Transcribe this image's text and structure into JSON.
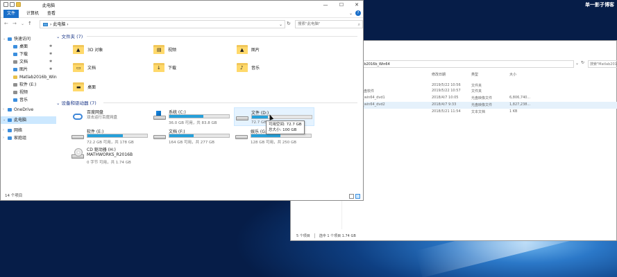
{
  "watermark": "单一影子博客",
  "back_window": {
    "address": "lab2016b_Win64",
    "search_placeholder": "搜索\"Matlab2016b_Wi...",
    "columns": [
      "修改日期",
      "类型",
      "大小"
    ],
    "rows": [
      {
        "name": "k",
        "date": "2019/5/22 10:56",
        "type": "文件夹",
        "size": ""
      },
      {
        "name": "光盘软件",
        "date": "2019/5/22 10:57",
        "type": "文件夹",
        "size": ""
      },
      {
        "name": "b_win64_dvd1",
        "date": "2018/4/7 10:05",
        "type": "光盘映像文件",
        "size": "6,806,740..."
      },
      {
        "name": "b_win64_dvd2",
        "date": "2018/4/7 9:33",
        "type": "光盘映像文件",
        "size": "1,827,238..."
      },
      {
        "name": "",
        "date": "2018/5/21 11:54",
        "type": "文本文档",
        "size": "1 KB"
      }
    ],
    "status_items": "5 个项目",
    "status_selected": "选中 1 个项目  1.74 GB"
  },
  "window": {
    "title": "此电脑",
    "controls": {
      "minimize": "—",
      "maximize": "☐",
      "close": "✕"
    },
    "ribbon_tabs": [
      "文件",
      "计算机",
      "查看"
    ],
    "address": "此电脑",
    "search_placeholder": "搜索\"此电脑\"",
    "status": "14 个项目"
  },
  "nav": [
    {
      "label": "快速访问",
      "icon": "star-icon",
      "color": "#3b8ede",
      "pinned": false
    },
    {
      "label": "桌面",
      "icon": "desktop-icon",
      "color": "#3b8ede",
      "pinned": true
    },
    {
      "label": "下载",
      "icon": "download-icon",
      "color": "#3b8ede",
      "pinned": true
    },
    {
      "label": "文档",
      "icon": "document-icon",
      "color": "#8f8f8f",
      "pinned": true
    },
    {
      "label": "图片",
      "icon": "pictures-icon",
      "color": "#3b8ede",
      "pinned": true
    },
    {
      "label": "Matlab2016b_Win",
      "icon": "folder-icon",
      "color": "#e8c04a",
      "pinned": false
    },
    {
      "label": "软件 (E:)",
      "icon": "drive-icon",
      "color": "#8f8f8f",
      "pinned": false
    },
    {
      "label": "视频",
      "icon": "video-icon",
      "color": "#8f8f8f",
      "pinned": false
    },
    {
      "label": "音乐",
      "icon": "music-icon",
      "color": "#3b8ede",
      "pinned": false
    },
    {
      "label": "OneDrive",
      "icon": "onedrive-icon",
      "color": "#3b8ede",
      "pinned": false
    },
    {
      "label": "此电脑",
      "icon": "pc-icon",
      "color": "#3b8ede",
      "pinned": false
    },
    {
      "label": "网络",
      "icon": "network-icon",
      "color": "#3b8ede",
      "pinned": false
    },
    {
      "label": "家庭组",
      "icon": "homegroup-icon",
      "color": "#3b8ede",
      "pinned": false
    }
  ],
  "folders_header": "文件夹 (7)",
  "folders": [
    {
      "label": "3D 对象",
      "glyph": "▲",
      "icon": "3d-objects-folder-icon"
    },
    {
      "label": "视频",
      "glyph": "▤",
      "icon": "video-folder-icon"
    },
    {
      "label": "图片",
      "glyph": "▲",
      "icon": "pictures-folder-icon"
    },
    {
      "label": "文档",
      "glyph": "▭",
      "icon": "documents-folder-icon"
    },
    {
      "label": "下载",
      "glyph": "↓",
      "icon": "downloads-folder-icon"
    },
    {
      "label": "音乐",
      "glyph": "♪",
      "icon": "music-folder-icon"
    },
    {
      "label": "桌面",
      "glyph": "▬",
      "icon": "desktop-folder-icon"
    }
  ],
  "drives_header": "设备和驱动器 (7)",
  "drives": [
    {
      "name": "百度网盘",
      "info": "双击运行百度网盘",
      "kind": "cloud"
    },
    {
      "name": "系统 (C:)",
      "info": "36.0 GB 可用，共 83.8 GB",
      "kind": "disk",
      "used": 0.57
    },
    {
      "name": "文件 (D:)",
      "info": "72.7 GB",
      "kind": "disk",
      "used": 0.27
    },
    {
      "name": "软件 (E:)",
      "info": "72.2 GB 可用，共 178 GB",
      "kind": "disk",
      "used": 0.59
    },
    {
      "name": "文档 (F:)",
      "info": "164 GB 可用，共 277 GB",
      "kind": "disk",
      "used": 0.41
    },
    {
      "name": "娱乐 (G:)",
      "info": "128 GB 可用，共 250 GB",
      "kind": "disk",
      "used": 0.49
    },
    {
      "name": "CD 驱动器 (H:) MATHWORKS_R2016B",
      "info": "0 字节 可用，共 1.74 GB",
      "kind": "cd"
    }
  ],
  "tooltip": {
    "line1": "可用空间: 72.7 GB",
    "line2": "总大小: 100 GB"
  }
}
